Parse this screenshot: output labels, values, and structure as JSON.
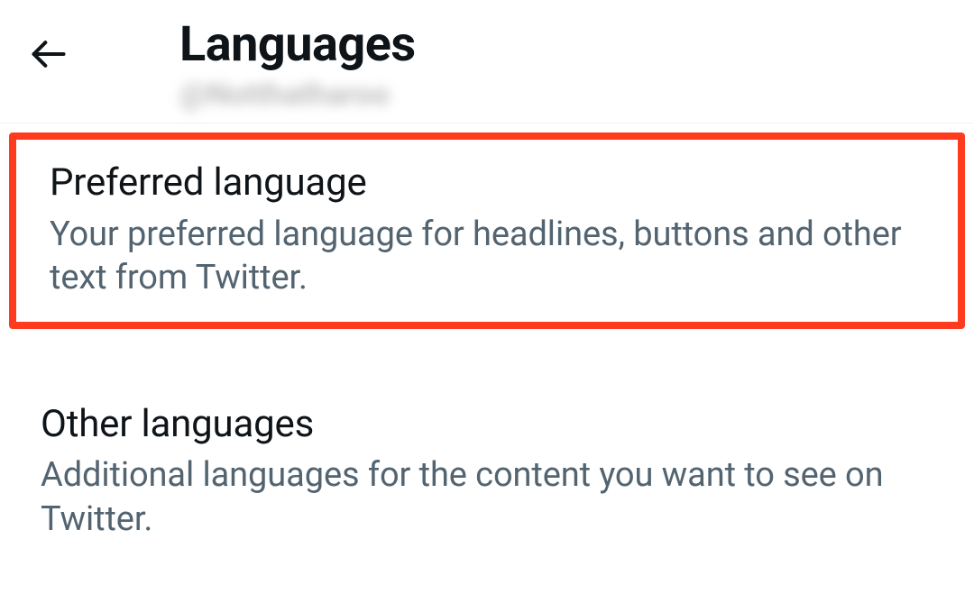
{
  "header": {
    "title": "Languages",
    "subtitle": "@Notthatharoo"
  },
  "settings": {
    "preferred": {
      "title": "Preferred language",
      "description": "Your preferred language for headlines, buttons and other text from Twitter."
    },
    "other": {
      "title": "Other languages",
      "description": "Additional languages for the content you want to see on Twitter."
    }
  }
}
